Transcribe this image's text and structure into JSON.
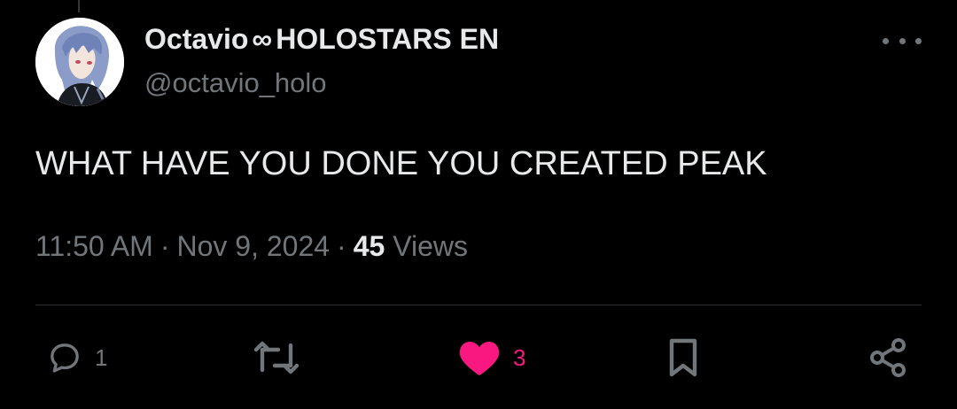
{
  "author": {
    "display_name": "Octavio",
    "name_glyph": "∞",
    "name_suffix": "HOLOSTARS EN",
    "handle": "@octavio_holo",
    "avatar": "avatar-image"
  },
  "tweet": {
    "text": "WHAT HAVE YOU DONE YOU CREATED PEAK"
  },
  "meta": {
    "time": "11:50 AM",
    "separator": "·",
    "date": "Nov 9, 2024",
    "views_count": "45",
    "views_label": "Views"
  },
  "actions": {
    "reply": {
      "icon": "reply-icon",
      "count": "1"
    },
    "retweet": {
      "icon": "retweet-icon"
    },
    "like": {
      "icon": "heart-icon",
      "count": "3",
      "active": true
    },
    "bookmark": {
      "icon": "bookmark-icon"
    },
    "share": {
      "icon": "share-icon"
    },
    "more": {
      "icon": "more-icon"
    }
  },
  "colors": {
    "background": "#000000",
    "primary_text": "#e7e9ea",
    "secondary_text": "#71767b",
    "like_active": "#f91880",
    "divider": "#2f3336"
  }
}
